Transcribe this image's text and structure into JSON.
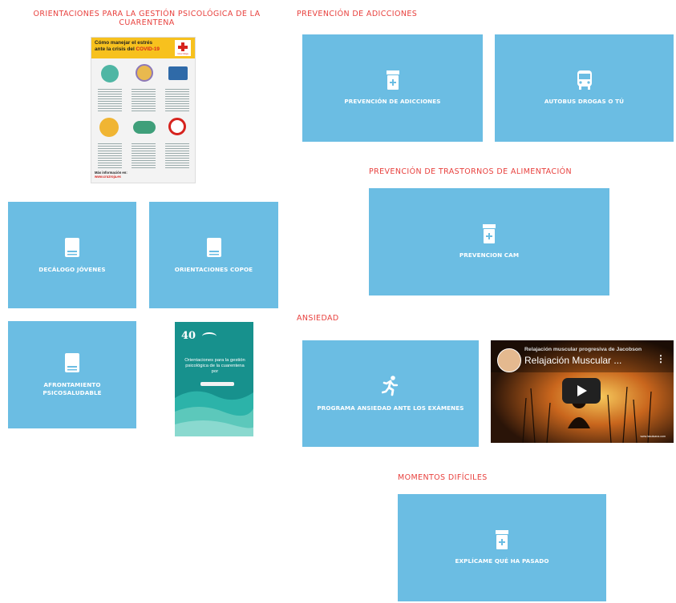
{
  "colors": {
    "heading": "#e8413e",
    "tile": "#6bbde3",
    "tile_text": "#ffffff"
  },
  "sections": {
    "orientaciones": {
      "title": "ORIENTACIONES PARA LA GESTIÓN PSICOLÓGICA DE LA CUARENTENA"
    },
    "adicciones": {
      "title": "PREVENCIÓN DE ADICCIONES"
    },
    "alimentacion": {
      "title": "PREVENCIÓN DE TRASTORNOS DE ALIMENTACIÓN"
    },
    "ansiedad": {
      "title": "ANSIEDAD"
    },
    "momentos": {
      "title": "MOMENTOS DIFÍCILES"
    }
  },
  "poster": {
    "title_line1": "Cómo manejar el estrés",
    "title_line2": "ante la crisis del",
    "title_highlight": "COVID-19",
    "brand": "Cruz Roja",
    "footer_line1": "Más información en:",
    "footer_line2": "www.cruzroja.es"
  },
  "tiles": {
    "decalogo": {
      "label": "DECÁLOGO JÓVENES",
      "icon": "book-icon"
    },
    "copoe": {
      "label": "ORIENTACIONES COPOE",
      "icon": "book-icon"
    },
    "afrontamiento": {
      "label": "AFRONTAMIENTO PSICOSALUDABLE",
      "icon": "book-icon"
    },
    "prev_adicciones": {
      "label": "PREVENCIÓN DE ADICCIONES",
      "icon": "medicine-jar-icon"
    },
    "autobus": {
      "label": "AUTOBUS DROGAS O TÚ",
      "icon": "bus-icon"
    },
    "cam": {
      "label": "PREVENCION CAM",
      "icon": "medicine-jar-icon"
    },
    "examenes": {
      "label": "PROGRAMA ANSIEDAD ANTE LOS EXÁMENES",
      "icon": "running-icon"
    },
    "explicame": {
      "label": "EXPLÍCAME QUÉ HA PASADO",
      "icon": "medicine-jar-icon"
    }
  },
  "book_cover": {
    "badge": "40",
    "text": "Orientaciones para la gestión psicológica de la cuarentena por"
  },
  "video": {
    "channel": "Relajación muscular progresiva de Jacobson",
    "title": "Relajación Muscular ...",
    "site": "www.lasuisana.com"
  }
}
